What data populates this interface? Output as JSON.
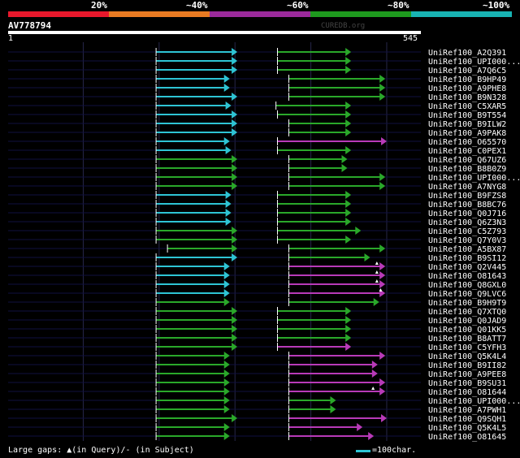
{
  "header": {
    "identity_labels": [
      "20%",
      "~40%",
      "~60%",
      "~80%",
      "~100%"
    ],
    "identity_colors": [
      "#e8182c",
      "#e87a22",
      "#9b2a9b",
      "#1e9a1e",
      "#18b4b4"
    ]
  },
  "query": {
    "name": "AV778794",
    "start_label": "1",
    "end_label": "545",
    "watermark": "CUREDB.org"
  },
  "colors": {
    "cyan": "#2ec4d4",
    "green": "#2aa82a",
    "magenta": "#b83ab8",
    "gridline": "#26264a",
    "baseline": "#101040"
  },
  "footer": {
    "gap_note": "Large gaps: ▲(in Query)/- (in Subject)",
    "scale_text": "=100char."
  },
  "chart_data": {
    "type": "alignment",
    "query_length": 545,
    "x_range": [
      1,
      545
    ],
    "hits": [
      {
        "name": "UniRef100_A2Q391",
        "segments": [
          {
            "start": 196,
            "end": 302,
            "color": "cyan"
          },
          {
            "start": 356,
            "end": 452,
            "color": "green"
          }
        ],
        "gaps": []
      },
      {
        "name": "UniRef100_UPI000...",
        "segments": [
          {
            "start": 196,
            "end": 302,
            "color": "cyan"
          },
          {
            "start": 356,
            "end": 452,
            "color": "green"
          }
        ],
        "gaps": []
      },
      {
        "name": "UniRef100_A7Q6C5",
        "segments": [
          {
            "start": 196,
            "end": 302,
            "color": "cyan"
          },
          {
            "start": 356,
            "end": 452,
            "color": "green"
          }
        ],
        "gaps": []
      },
      {
        "name": "UniRef100_B9HP49",
        "segments": [
          {
            "start": 196,
            "end": 292,
            "color": "cyan"
          },
          {
            "start": 371,
            "end": 497,
            "color": "green"
          }
        ],
        "gaps": []
      },
      {
        "name": "UniRef100_A9PHE8",
        "segments": [
          {
            "start": 196,
            "end": 292,
            "color": "cyan"
          },
          {
            "start": 371,
            "end": 497,
            "color": "green"
          }
        ],
        "gaps": []
      },
      {
        "name": "UniRef100_B9N328",
        "segments": [
          {
            "start": 196,
            "end": 302,
            "color": "cyan"
          },
          {
            "start": 371,
            "end": 497,
            "color": "green"
          }
        ],
        "gaps": []
      },
      {
        "name": "UniRef100_C5XAR5",
        "segments": [
          {
            "start": 196,
            "end": 294,
            "color": "cyan"
          },
          {
            "start": 354,
            "end": 452,
            "color": "green"
          }
        ],
        "gaps": []
      },
      {
        "name": "UniRef100_B9T554",
        "segments": [
          {
            "start": 196,
            "end": 302,
            "color": "cyan"
          },
          {
            "start": 356,
            "end": 452,
            "color": "green"
          }
        ],
        "gaps": []
      },
      {
        "name": "UniRef100_B9ILW2",
        "segments": [
          {
            "start": 196,
            "end": 302,
            "color": "cyan"
          },
          {
            "start": 371,
            "end": 452,
            "color": "green"
          }
        ],
        "gaps": []
      },
      {
        "name": "UniRef100_A9PAK8",
        "segments": [
          {
            "start": 196,
            "end": 302,
            "color": "cyan"
          },
          {
            "start": 371,
            "end": 452,
            "color": "green"
          }
        ],
        "gaps": []
      },
      {
        "name": "UniRef100_O65570",
        "segments": [
          {
            "start": 196,
            "end": 292,
            "color": "cyan"
          },
          {
            "start": 356,
            "end": 499,
            "color": "magenta"
          }
        ],
        "gaps": []
      },
      {
        "name": "UniRef100_C0PEX1",
        "segments": [
          {
            "start": 196,
            "end": 294,
            "color": "cyan"
          },
          {
            "start": 356,
            "end": 452,
            "color": "green"
          }
        ],
        "gaps": []
      },
      {
        "name": "UniRef100_Q67UZ6",
        "segments": [
          {
            "start": 196,
            "end": 302,
            "color": "green"
          },
          {
            "start": 371,
            "end": 447,
            "color": "green"
          }
        ],
        "gaps": []
      },
      {
        "name": "UniRef100_B8B0Z9",
        "segments": [
          {
            "start": 196,
            "end": 302,
            "color": "green"
          },
          {
            "start": 371,
            "end": 447,
            "color": "green"
          }
        ],
        "gaps": []
      },
      {
        "name": "UniRef100_UPI000...",
        "segments": [
          {
            "start": 196,
            "end": 302,
            "color": "green"
          },
          {
            "start": 371,
            "end": 497,
            "color": "green"
          }
        ],
        "gaps": []
      },
      {
        "name": "UniRef100_A7NYG8",
        "segments": [
          {
            "start": 196,
            "end": 302,
            "color": "green"
          },
          {
            "start": 371,
            "end": 497,
            "color": "green"
          }
        ],
        "gaps": []
      },
      {
        "name": "UniRef100_B9FZS8",
        "segments": [
          {
            "start": 196,
            "end": 294,
            "color": "cyan"
          },
          {
            "start": 356,
            "end": 452,
            "color": "green"
          }
        ],
        "gaps": []
      },
      {
        "name": "UniRef100_B8BC76",
        "segments": [
          {
            "start": 196,
            "end": 294,
            "color": "cyan"
          },
          {
            "start": 356,
            "end": 452,
            "color": "green"
          }
        ],
        "gaps": []
      },
      {
        "name": "UniRef100_Q0J716",
        "segments": [
          {
            "start": 196,
            "end": 294,
            "color": "cyan"
          },
          {
            "start": 356,
            "end": 452,
            "color": "green"
          }
        ],
        "gaps": []
      },
      {
        "name": "UniRef100_Q6Z3N3",
        "segments": [
          {
            "start": 196,
            "end": 294,
            "color": "cyan"
          },
          {
            "start": 356,
            "end": 452,
            "color": "green"
          }
        ],
        "gaps": []
      },
      {
        "name": "UniRef100_C5Z793",
        "segments": [
          {
            "start": 196,
            "end": 302,
            "color": "green"
          },
          {
            "start": 356,
            "end": 465,
            "color": "green"
          }
        ],
        "gaps": []
      },
      {
        "name": "UniRef100_Q7Y0V3",
        "segments": [
          {
            "start": 196,
            "end": 302,
            "color": "green"
          },
          {
            "start": 356,
            "end": 452,
            "color": "green"
          }
        ],
        "gaps": []
      },
      {
        "name": "UniRef100_A5BX87",
        "segments": [
          {
            "start": 211,
            "end": 302,
            "color": "green"
          },
          {
            "start": 371,
            "end": 497,
            "color": "green"
          }
        ],
        "gaps": []
      },
      {
        "name": "UniRef100_B9SI12",
        "segments": [
          {
            "start": 196,
            "end": 302,
            "color": "cyan"
          },
          {
            "start": 371,
            "end": 477,
            "color": "green"
          }
        ],
        "gaps": []
      },
      {
        "name": "UniRef100_Q2V445",
        "segments": [
          {
            "start": 196,
            "end": 292,
            "color": "cyan"
          },
          {
            "start": 371,
            "end": 497,
            "color": "magenta"
          }
        ],
        "gaps": [
          487
        ]
      },
      {
        "name": "UniRef100_O81643",
        "segments": [
          {
            "start": 196,
            "end": 292,
            "color": "cyan"
          },
          {
            "start": 371,
            "end": 497,
            "color": "magenta"
          }
        ],
        "gaps": [
          487
        ]
      },
      {
        "name": "UniRef100_Q8GXL0",
        "segments": [
          {
            "start": 196,
            "end": 292,
            "color": "cyan"
          },
          {
            "start": 371,
            "end": 497,
            "color": "magenta"
          }
        ],
        "gaps": [
          487
        ]
      },
      {
        "name": "UniRef100_Q9LVC6",
        "segments": [
          {
            "start": 196,
            "end": 292,
            "color": "cyan"
          },
          {
            "start": 371,
            "end": 497,
            "color": "magenta"
          }
        ],
        "gaps": [
          492
        ]
      },
      {
        "name": "UniRef100_B9H9T9",
        "segments": [
          {
            "start": 196,
            "end": 292,
            "color": "green"
          },
          {
            "start": 371,
            "end": 489,
            "color": "green"
          }
        ],
        "gaps": []
      },
      {
        "name": "UniRef100_Q7XTQ0",
        "segments": [
          {
            "start": 196,
            "end": 302,
            "color": "green"
          },
          {
            "start": 356,
            "end": 452,
            "color": "green"
          }
        ],
        "gaps": []
      },
      {
        "name": "UniRef100_Q0JAD9",
        "segments": [
          {
            "start": 196,
            "end": 302,
            "color": "green"
          },
          {
            "start": 356,
            "end": 452,
            "color": "green"
          }
        ],
        "gaps": []
      },
      {
        "name": "UniRef100_Q01KK5",
        "segments": [
          {
            "start": 196,
            "end": 302,
            "color": "green"
          },
          {
            "start": 356,
            "end": 452,
            "color": "green"
          }
        ],
        "gaps": []
      },
      {
        "name": "UniRef100_B8ATT7",
        "segments": [
          {
            "start": 196,
            "end": 302,
            "color": "green"
          },
          {
            "start": 356,
            "end": 452,
            "color": "green"
          }
        ],
        "gaps": []
      },
      {
        "name": "UniRef100_C5YFH3",
        "segments": [
          {
            "start": 196,
            "end": 302,
            "color": "green"
          },
          {
            "start": 356,
            "end": 452,
            "color": "magenta"
          }
        ],
        "gaps": []
      },
      {
        "name": "UniRef100_Q5K4L4",
        "segments": [
          {
            "start": 196,
            "end": 292,
            "color": "green"
          },
          {
            "start": 371,
            "end": 497,
            "color": "magenta"
          }
        ],
        "gaps": []
      },
      {
        "name": "UniRef100_B9II82",
        "segments": [
          {
            "start": 196,
            "end": 292,
            "color": "green"
          },
          {
            "start": 371,
            "end": 487,
            "color": "magenta"
          }
        ],
        "gaps": []
      },
      {
        "name": "UniRef100_A9PEE8",
        "segments": [
          {
            "start": 196,
            "end": 292,
            "color": "green"
          },
          {
            "start": 371,
            "end": 487,
            "color": "magenta"
          }
        ],
        "gaps": []
      },
      {
        "name": "UniRef100_B9SU31",
        "segments": [
          {
            "start": 196,
            "end": 292,
            "color": "green"
          },
          {
            "start": 371,
            "end": 497,
            "color": "magenta"
          }
        ],
        "gaps": []
      },
      {
        "name": "UniRef100_O81644",
        "segments": [
          {
            "start": 196,
            "end": 292,
            "color": "green"
          },
          {
            "start": 371,
            "end": 497,
            "color": "magenta"
          }
        ],
        "gaps": [
          482
        ]
      },
      {
        "name": "UniRef100_UPI000...",
        "segments": [
          {
            "start": 196,
            "end": 292,
            "color": "green"
          },
          {
            "start": 371,
            "end": 432,
            "color": "green"
          }
        ],
        "gaps": []
      },
      {
        "name": "UniRef100_A7PWH1",
        "segments": [
          {
            "start": 196,
            "end": 292,
            "color": "green"
          },
          {
            "start": 371,
            "end": 432,
            "color": "green"
          }
        ],
        "gaps": []
      },
      {
        "name": "UniRef100_Q9SQH1",
        "segments": [
          {
            "start": 196,
            "end": 302,
            "color": "green"
          },
          {
            "start": 371,
            "end": 499,
            "color": "magenta"
          }
        ],
        "gaps": []
      },
      {
        "name": "UniRef100_Q5K4L5",
        "segments": [
          {
            "start": 196,
            "end": 292,
            "color": "green"
          },
          {
            "start": 371,
            "end": 467,
            "color": "magenta"
          }
        ],
        "gaps": []
      },
      {
        "name": "UniRef100_O81645",
        "segments": [
          {
            "start": 196,
            "end": 292,
            "color": "green"
          },
          {
            "start": 371,
            "end": 482,
            "color": "magenta"
          }
        ],
        "gaps": []
      }
    ]
  }
}
